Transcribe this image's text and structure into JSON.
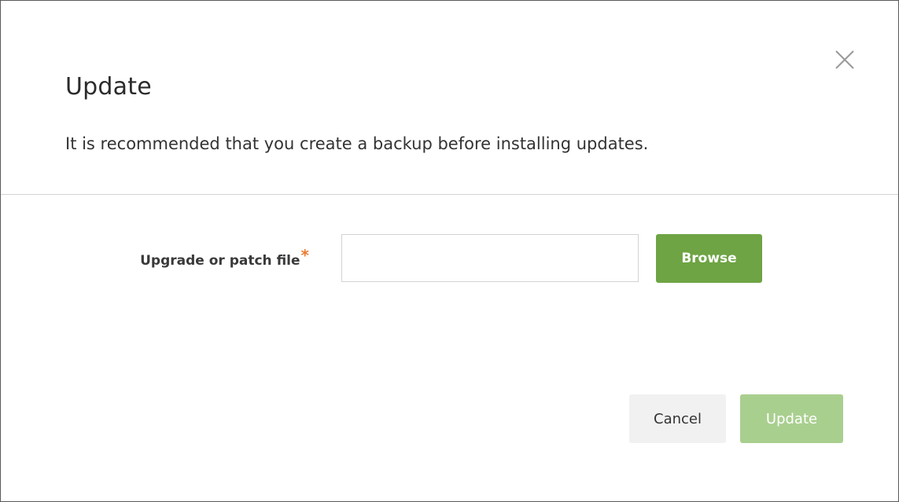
{
  "dialog": {
    "title": "Update",
    "subtitle": "It is recommended that you create a backup before installing updates.",
    "close_icon": "close-icon"
  },
  "form": {
    "file_label": "Upgrade or patch file",
    "required_marker": "*",
    "file_value": "",
    "browse_label": "Browse"
  },
  "footer": {
    "cancel_label": "Cancel",
    "update_label": "Update"
  },
  "colors": {
    "accent_green": "#6ea444",
    "disabled_green": "#a9cf8f",
    "required_orange": "#ee7a32"
  }
}
